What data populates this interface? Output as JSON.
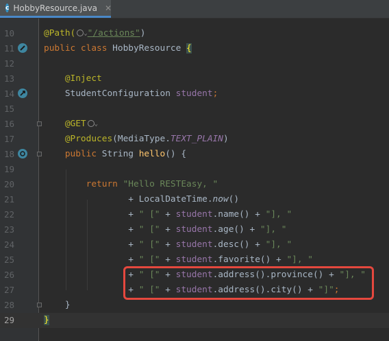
{
  "tab": {
    "title": "HobbyResource.java",
    "icon": "java-class-icon",
    "close": "✕",
    "icon_letter": "c"
  },
  "colors": {
    "background": "#2b2b2b",
    "gutter": "#313335",
    "keyword": "#cc7832",
    "annotation": "#bbb529",
    "string": "#6a8759",
    "field": "#9876aa",
    "highlight_box": "#e5483e"
  },
  "lines": [
    {
      "num": "10",
      "tokens": [
        [
          "ann",
          "@Path("
        ],
        [
          "globe",
          ""
        ],
        [
          "caret",
          "⌄"
        ],
        [
          "str u",
          "\"/actions\""
        ],
        [
          "txt",
          ")"
        ]
      ]
    },
    {
      "num": "11",
      "tokens": [
        [
          "kw",
          "public class "
        ],
        [
          "txt",
          "HobbyResource "
        ],
        [
          "hlb",
          "{"
        ]
      ]
    },
    {
      "num": "12",
      "tokens": []
    },
    {
      "num": "13",
      "tokens": [
        [
          "ann",
          "    @Inject"
        ]
      ]
    },
    {
      "num": "14",
      "tokens": [
        [
          "txt",
          "    StudentConfiguration "
        ],
        [
          "fld",
          "student"
        ],
        [
          "kw",
          ";"
        ]
      ]
    },
    {
      "num": "15",
      "tokens": []
    },
    {
      "num": "16",
      "tokens": [
        [
          "ann",
          "    @GET"
        ],
        [
          "globe",
          ""
        ],
        [
          "caret",
          "⌄"
        ]
      ]
    },
    {
      "num": "17",
      "tokens": [
        [
          "ann",
          "    @Produces"
        ],
        [
          "txt",
          "(MediaType."
        ],
        [
          "fld it",
          "TEXT_PLAIN"
        ],
        [
          "txt",
          ")"
        ]
      ]
    },
    {
      "num": "18",
      "tokens": [
        [
          "kw",
          "    public "
        ],
        [
          "txt",
          "String "
        ],
        [
          "fn",
          "hello"
        ],
        [
          "txt",
          "() {"
        ]
      ]
    },
    {
      "num": "19",
      "tokens": []
    },
    {
      "num": "20",
      "tokens": [
        [
          "kw",
          "        return "
        ],
        [
          "str",
          "\"Hello RESTEasy, \""
        ]
      ]
    },
    {
      "num": "21",
      "tokens": [
        [
          "txt",
          "                + LocalDateTime."
        ],
        [
          "it",
          "now"
        ],
        [
          "txt",
          "()"
        ]
      ]
    },
    {
      "num": "22",
      "tokens": [
        [
          "txt",
          "                + "
        ],
        [
          "str",
          "\" [\""
        ],
        [
          "txt",
          " + "
        ],
        [
          "fld",
          "student"
        ],
        [
          "txt",
          ".name() + "
        ],
        [
          "str",
          "\"], \""
        ]
      ]
    },
    {
      "num": "23",
      "tokens": [
        [
          "txt",
          "                + "
        ],
        [
          "str",
          "\" [\""
        ],
        [
          "txt",
          " + "
        ],
        [
          "fld",
          "student"
        ],
        [
          "txt",
          ".age() + "
        ],
        [
          "str",
          "\"], \""
        ]
      ]
    },
    {
      "num": "24",
      "tokens": [
        [
          "txt",
          "                + "
        ],
        [
          "str",
          "\" [\""
        ],
        [
          "txt",
          " + "
        ],
        [
          "fld",
          "student"
        ],
        [
          "txt",
          ".desc() + "
        ],
        [
          "str",
          "\"], \""
        ]
      ]
    },
    {
      "num": "25",
      "tokens": [
        [
          "txt",
          "                + "
        ],
        [
          "str",
          "\" [\""
        ],
        [
          "txt",
          " + "
        ],
        [
          "fld",
          "student"
        ],
        [
          "txt",
          ".favorite() + "
        ],
        [
          "str",
          "\"], \""
        ]
      ]
    },
    {
      "num": "26",
      "tokens": [
        [
          "txt",
          "                + "
        ],
        [
          "str",
          "\" [\""
        ],
        [
          "txt",
          " + "
        ],
        [
          "fld",
          "student"
        ],
        [
          "txt",
          ".address().province() + "
        ],
        [
          "str",
          "\"], \""
        ]
      ]
    },
    {
      "num": "27",
      "tokens": [
        [
          "txt",
          "                + "
        ],
        [
          "str",
          "\" [\""
        ],
        [
          "txt",
          " + "
        ],
        [
          "fld",
          "student"
        ],
        [
          "txt",
          ".address().city() + "
        ],
        [
          "str",
          "\"]\""
        ],
        [
          "kw",
          ";"
        ]
      ]
    },
    {
      "num": "28",
      "tokens": [
        [
          "txt",
          "    }"
        ]
      ]
    },
    {
      "num": "29",
      "tokens": [
        [
          "hlb",
          "}"
        ]
      ]
    }
  ]
}
